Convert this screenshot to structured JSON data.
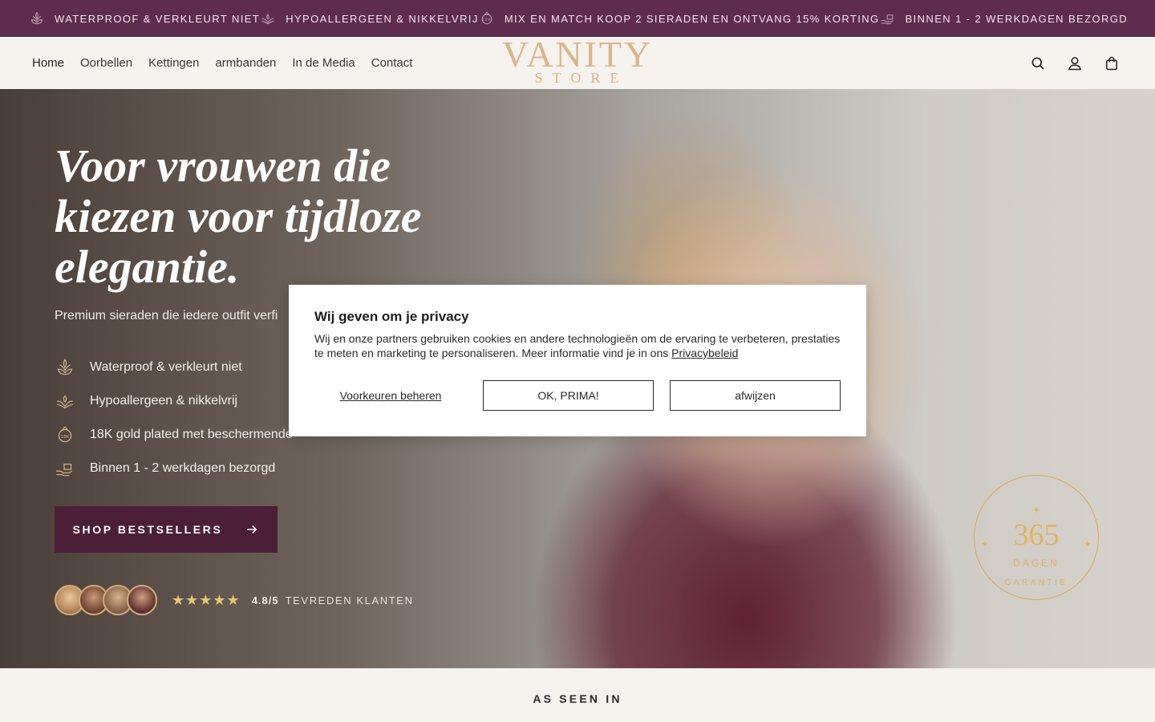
{
  "announcements": [
    {
      "text": "WATERPROOF & VERKLEURT NIET",
      "icon": "lotus-icon"
    },
    {
      "text": "HYPOALLERGEEN & NIKKELVRIJ",
      "icon": "lotus-hands-icon"
    },
    {
      "text": "MIX EN MATCH KOOP 2 SIERADEN EN ONTVANG 15% KORTING",
      "icon": "gold-badge-icon"
    },
    {
      "text": "BINNEN 1 - 2 WERKDAGEN BEZORGD",
      "icon": "delivery-hand-icon"
    }
  ],
  "nav": {
    "items": [
      "Home",
      "Oorbellen",
      "Kettingen",
      "armbanden",
      "In de Media",
      "Contact"
    ]
  },
  "logo": {
    "top": "VANITY",
    "bottom": "STORE"
  },
  "header_icons": [
    "search-icon",
    "account-icon",
    "bag-icon"
  ],
  "hero": {
    "title": "Voor vrouwen die kiezen voor tijdloze elegantie.",
    "subtitle": "Premium sieraden die iedere outfit verfi",
    "features": [
      "Waterproof & verkleurt niet",
      "Hypoallergeen & nikkelvrij",
      "18K gold plated met beschermende",
      "Binnen 1 - 2 werkdagen bezorgd"
    ],
    "cta": "SHOP BESTSELLERS",
    "stars": "★★★★★",
    "rating": "4.8/5",
    "rating_label": "TEVREDEN KLANTEN",
    "guarantee": {
      "number": "365",
      "days": "DAGEN",
      "label": "GARANTIE"
    }
  },
  "cookie": {
    "title": "Wij geven om je privacy",
    "text": "Wij en onze partners gebruiken cookies en andere technologieën om de ervaring te verbeteren, prestaties te meten en marketing te personaliseren. Meer informatie vind je in ons ",
    "policy_link": "Privacybeleid",
    "manage": "Voorkeuren beheren",
    "accept": "OK, PRIMA!",
    "reject": "afwijzen"
  },
  "seen": {
    "title": "AS SEEN IN"
  },
  "colors": {
    "brand": "#5e2c4f",
    "cta": "#4a1f37",
    "gold": "#d9b68b",
    "background": "#f6f2ee"
  }
}
